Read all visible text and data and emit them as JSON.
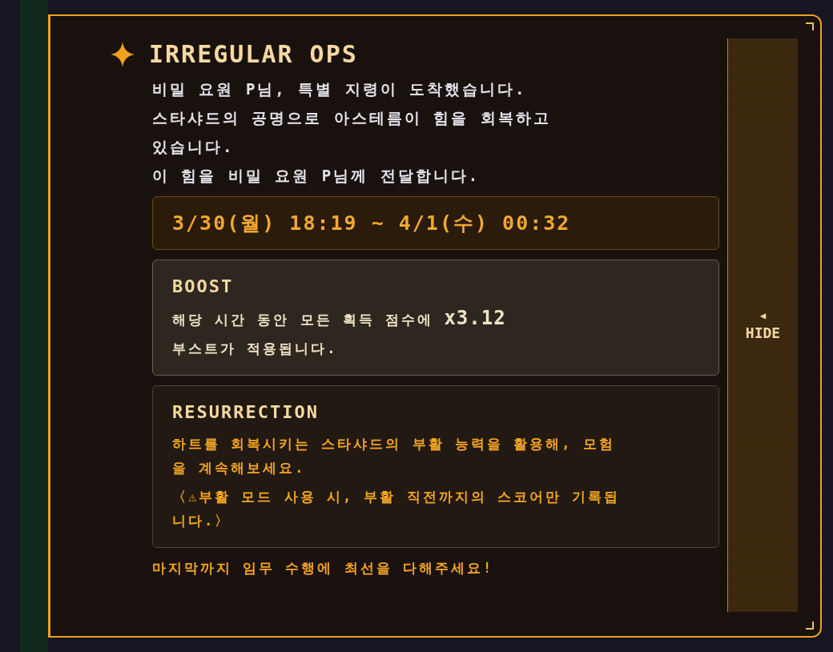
{
  "title": "IRREGULAR OPS",
  "intro": [
    "비밀 요원 P님, 특별 지령이 도착했습니다.",
    "스타샤드의 공명으로 아스테름이 힘을 회복하고 있습니다.",
    "이 힘을 비밀 요원 P님께 전달합니다."
  ],
  "period": "3/30(월) 18:19 ~ 4/1(수) 00:32",
  "cards": [
    {
      "kind": "boost",
      "heading": "BOOST",
      "body": [
        "해당 시간 동안 모든 획득 점수에 **x3.12**",
        "부스트가 적용됩니다."
      ]
    },
    {
      "kind": "resurrection",
      "heading": "RESURRECTION",
      "body": [
        "하트를 회복시키는 스타샤드의 부활 능력을 활용해, 모험을 계속해보세요.",
        "〈⚠부활 모드 사용 시, 부활 직전까지의 스코어만 기록됩니다.〉"
      ]
    }
  ],
  "footer": "마지막까지 임무 수행에 최선을 다해주세요!",
  "hide_button": {
    "arrow": "◀",
    "label": "HIDE"
  }
}
